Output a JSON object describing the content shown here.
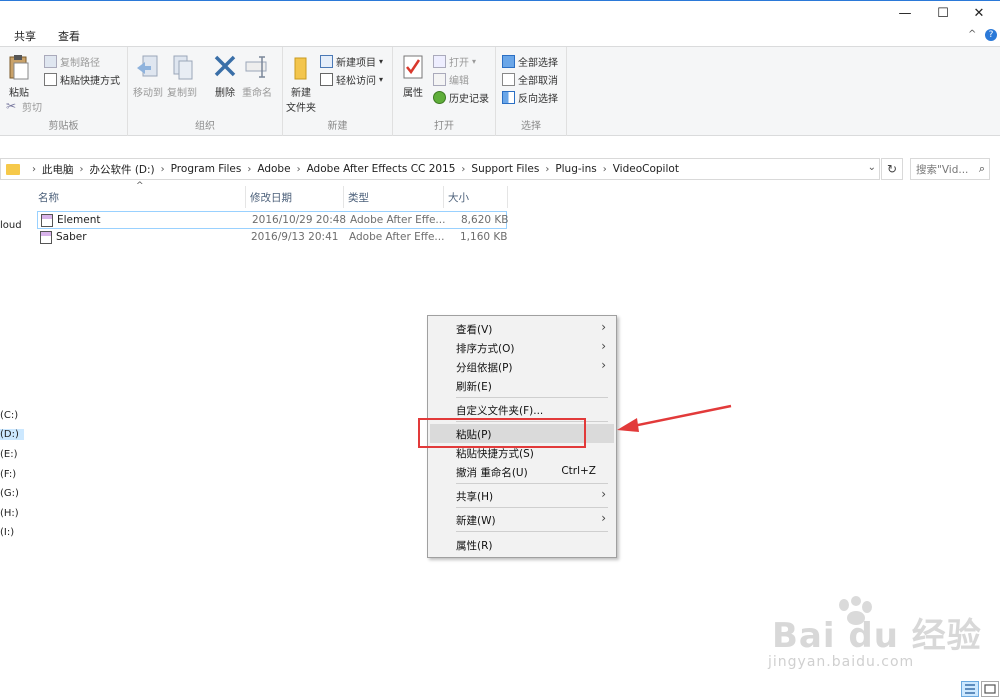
{
  "window": {
    "minimize": "—",
    "maximize": "☐",
    "close": "✕",
    "help_icon": "?",
    "collapse_icon": "^"
  },
  "tabs": [
    "共享",
    "查看"
  ],
  "ribbon": {
    "clipboard": {
      "label": "剪贴板",
      "paste": "粘贴",
      "copy_path": "复制路径",
      "paste_shortcut": "粘贴快捷方式",
      "cut": "剪切"
    },
    "organize": {
      "label": "组织",
      "move_to": "移动到",
      "copy_to": "复制到",
      "delete": "删除",
      "rename": "重命名"
    },
    "new": {
      "label": "新建",
      "new_folder_l1": "新建",
      "new_folder_l2": "文件夹",
      "new_item": "新建项目",
      "easy_access": "轻松访问"
    },
    "open": {
      "label": "打开",
      "properties": "属性",
      "open": "打开",
      "edit": "编辑",
      "history": "历史记录"
    },
    "select": {
      "label": "选择",
      "select_all": "全部选择",
      "select_none": "全部取消",
      "invert": "反向选择"
    }
  },
  "address": {
    "crumbs": [
      "此电脑",
      "办公软件 (D:)",
      "Program Files",
      "Adobe",
      "Adobe After Effects CC 2015",
      "Support Files",
      "Plug-ins",
      "VideoCopilot"
    ],
    "search_placeholder": "搜索\"Vid...",
    "refresh_icon": "↻",
    "dropdown_icon": "⌄"
  },
  "nav": [
    "loud",
    "(C:)",
    "(D:)",
    "(E:)",
    "(F:)",
    "(G:)",
    "(H:)",
    "(I:)"
  ],
  "columns": [
    "名称",
    "修改日期",
    "类型",
    "大小"
  ],
  "files": [
    {
      "name": "Element",
      "date": "2016/10/29 20:48",
      "type": "Adobe After Effe...",
      "size": "8,620 KB"
    },
    {
      "name": "Saber",
      "date": "2016/9/13 20:41",
      "type": "Adobe After Effe...",
      "size": "1,160 KB"
    }
  ],
  "context_menu": {
    "view": "查看(V)",
    "sort": "排序方式(O)",
    "group": "分组依据(P)",
    "refresh": "刷新(E)",
    "customize": "自定义文件夹(F)...",
    "paste": "粘贴(P)",
    "paste_shortcut": "粘贴快捷方式(S)",
    "undo": "撤消 重命名(U)",
    "undo_shortcut": "Ctrl+Z",
    "share": "共享(H)",
    "new": "新建(W)",
    "properties": "属性(R)"
  },
  "watermark": {
    "logo": "Bai du 经验",
    "url": "jingyan.baidu.com"
  },
  "colors": {
    "accent": "#2b79d8",
    "selection": "#cce8ff",
    "annotation": "#e23a3a"
  }
}
